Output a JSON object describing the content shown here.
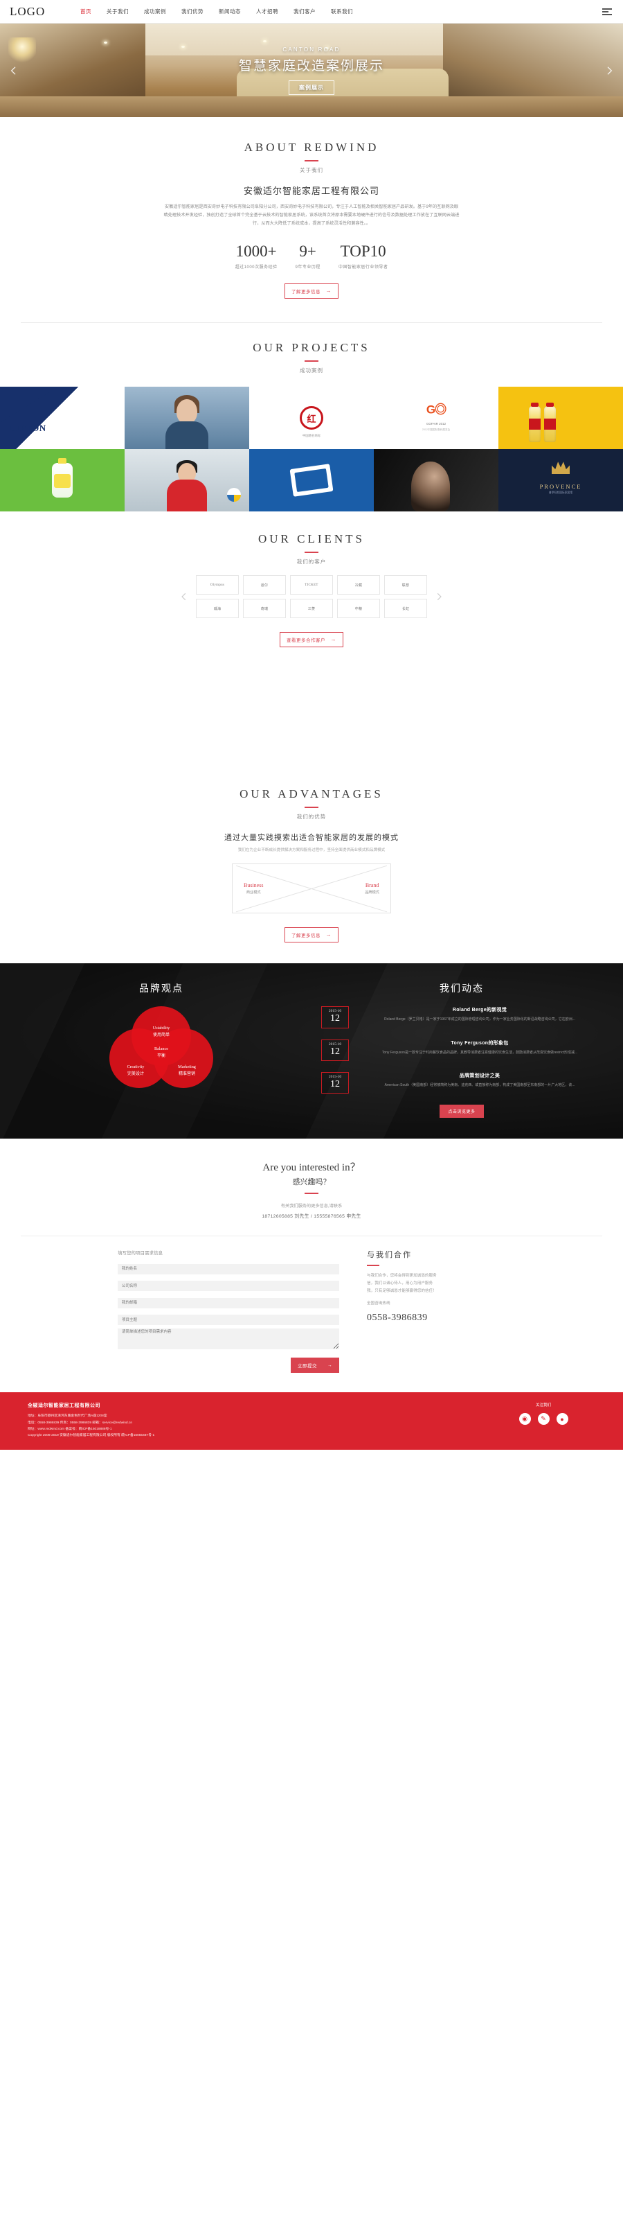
{
  "header": {
    "logo": "LOGO",
    "nav": [
      {
        "label": "首页",
        "active": true
      },
      {
        "label": "关于我们",
        "active": false
      },
      {
        "label": "成功案例",
        "active": false
      },
      {
        "label": "我们优势",
        "active": false
      },
      {
        "label": "新闻动态",
        "active": false
      },
      {
        "label": "人才招聘",
        "active": false
      },
      {
        "label": "我们客户",
        "active": false
      },
      {
        "label": "联系我们",
        "active": false
      }
    ],
    "menu_icon": "hamburger-icon"
  },
  "hero": {
    "eyebrow": "CANTON ROAD",
    "title": "智慧家庭改造案例展示",
    "button": "案例展示",
    "prev_icon": "chevron-left-icon",
    "next_icon": "chevron-right-icon"
  },
  "about": {
    "title_en": "ABOUT REDWIND",
    "title_cn": "关于我们",
    "company": "安徽适尔智能家居工程有限公司",
    "paragraph": "安徽适尔智能家居是西安奇妙电子科技有限公司阜阳分公司，西安奇妙电子科技有限公司，专注于人工智能及相关智能家居产品研发。基于9年的互联网及眼睛处理技术开发经验，独创打造了全球首个完全基于云技术的智能家居系统，该系统首次将原本需要本地硬件进行的信号及数据处理工作放在了互联网云端进行，从而大大降低了系统成本，提高了系统灵活性和兼容性。。",
    "stats": [
      {
        "value": "1000+",
        "label": "超过1000次服务经验"
      },
      {
        "value": "9+",
        "label": "9年专业历程"
      },
      {
        "value": "TOP10",
        "label": "中国智能家居行业领导者"
      }
    ],
    "cta": "了解更多信息"
  },
  "projects": {
    "title_en": "OUR PROJECTS",
    "title_cn": "成功案例",
    "items": [
      {
        "name": "LIPTON",
        "caption": "LIPTON"
      },
      {
        "name": "person-portrait",
        "caption": ""
      },
      {
        "name": "中国驰名商标",
        "caption": "中国驰名商标"
      },
      {
        "name": "GOFAIR 2012",
        "caption": "2012中国国际数码展览会",
        "sub": "GOFAIR 2012"
      },
      {
        "name": "beverage-bottles",
        "caption": ""
      },
      {
        "name": "soap-product",
        "caption": ""
      },
      {
        "name": "volleyball-athlete",
        "caption": ""
      },
      {
        "name": "blue-poster",
        "caption": ""
      },
      {
        "name": "portrait-dark",
        "caption": ""
      },
      {
        "name": "PROVENCE",
        "caption": "PROVENCE",
        "sub": "普罗旺斯国际家居馆"
      }
    ]
  },
  "clients": {
    "title_en": "OUR CLIENTS",
    "title_cn": "我们的客户",
    "row1": [
      "Olympus",
      "适尔",
      "TICKET",
      "冷藏",
      "联想"
    ],
    "row2": [
      "威海",
      "奇瑞",
      "三菱",
      "中粮",
      "长虹"
    ],
    "cta": "查看更多合作客户",
    "prev_icon": "chevron-left-icon",
    "next_icon": "chevron-right-icon"
  },
  "advantages": {
    "title_en": "OUR ADVANTAGES",
    "title_cn": "我们的优势",
    "lead": "通过大量实践摸索出适合智能家居的发展的模式",
    "sub": "我们在为企业不断成长提供解决方案和服务过程中，坚持全面提供商业模式和品牌模式",
    "node_left_en": "Business",
    "node_left_cn": "商业模式",
    "node_right_en": "Brand",
    "node_right_cn": "品牌模式",
    "cta": "了解更多信息"
  },
  "dark": {
    "brand_view_title": "品牌观点",
    "venn": [
      {
        "en": "Ustability",
        "cn": "使用简单"
      },
      {
        "en": "Balance",
        "cn": "平衡"
      },
      {
        "en": "Creativity",
        "cn": "完美设计"
      },
      {
        "en": "Marketing",
        "cn": "精准营销"
      }
    ],
    "news_title": "我们动态",
    "news": [
      {
        "ym": "2015-10",
        "day": "12",
        "title": "Roland Berge的新视觉",
        "desc": "Roland Berge（罗兰贝格）是一家于1967年成立的国际管理咨询公司，作为一家业务国际化的新沿战略咨询公司，它在欧洲..."
      },
      {
        "ym": "2015-10",
        "day": "12",
        "title": "Tony Ferguson的形象包",
        "desc": "Tony Ferguson是一款专注于时尚餐饮食品的品牌，其教导消费者注意健康的饮食生活，鼓励消费者从改变饮食做restrict形成减..."
      },
      {
        "ym": "2015-10",
        "day": "12",
        "title": "品牌策划设计之美",
        "desc": "American South（美国南部）经常被简称为美南、迪克西、或直接称为南部，构成了美国南部至东南部的一片广大地区，该..."
      }
    ],
    "more_button": "点击浏览更多"
  },
  "interested": {
    "en": "Are you interested in？",
    "cn": "感兴趣吗？",
    "line1": "有关我们服务的更多信息,请联系",
    "line2": "18712605885 刘先生 / 15555876565 申先生"
  },
  "contact": {
    "form_title": "填写您的项目需求信息",
    "fields": [
      {
        "placeholder": "我的姓名"
      },
      {
        "placeholder": "公司名称"
      },
      {
        "placeholder": "我的邮箱"
      },
      {
        "placeholder": "项目主题"
      },
      {
        "placeholder": "请简单描述您的项目需求内容"
      }
    ],
    "submit": "立即提交",
    "info_title": "与我们合作",
    "info_line1": "与我们合作，您将会得到更加诚恳的服务",
    "info_line2": "信，我们以诚心待人，用心为用户服务",
    "info_line3": "我，只有足够诚恳才能够赢得您的信任！",
    "info_label": "全国咨询热线",
    "info_phone": "0558-3986839"
  },
  "footer": {
    "title": "全椒适尔智能家居工程有限公司",
    "lines": [
      "地址：阜阳市颍州区清河东路金色时代广场A座1208室",
      "电话：0558-3986839  传真：0558-3986839  邮箱：service@redwind.cn",
      "网址：www.redwind.com   备案号：皖ICP备15018888号-1",
      "Copyright 2006-2019 安徽适尔智能家居工程有限公司 版权所有 皖ICP备16055487号-1"
    ],
    "social_label": "关注我们",
    "socials": [
      "weibo-icon",
      "wechat-icon",
      "qq-icon"
    ]
  },
  "colors": {
    "brand_red": "#d9232e",
    "accent_red": "#d9434f",
    "dark_bg": "#121212"
  }
}
